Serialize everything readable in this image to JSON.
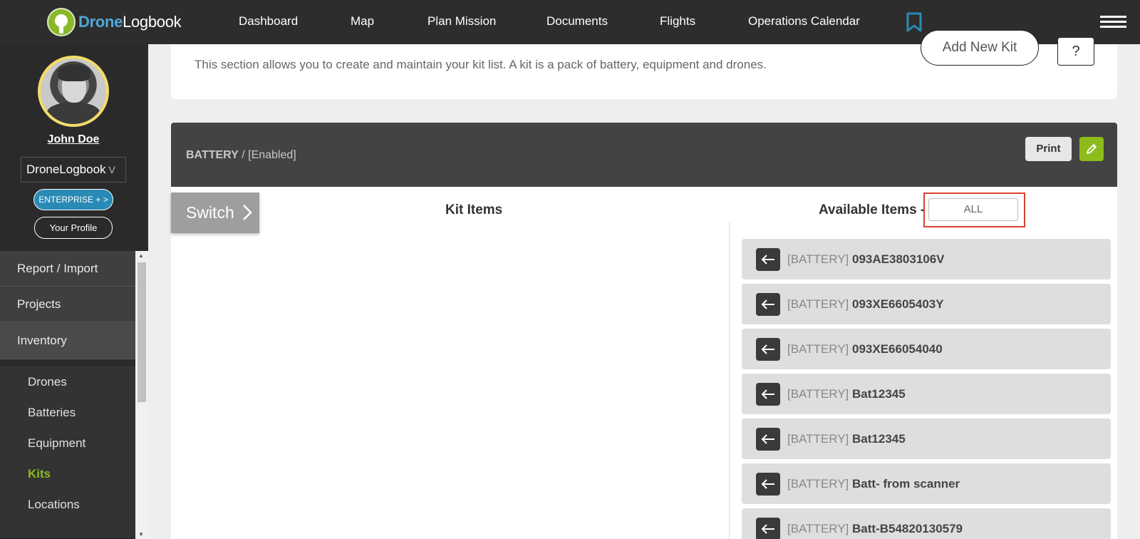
{
  "nav": {
    "logo_drone": "Drone",
    "logo_logbook": "Logbook",
    "links": [
      "Dashboard",
      "Map",
      "Plan Mission",
      "Documents",
      "Flights",
      "Operations Calendar"
    ],
    "bookmark_color": "#2a8ab6"
  },
  "sidebar": {
    "user_name": "John Doe",
    "org": "DroneLogbook",
    "org_chevron": "V",
    "enterprise_label": "ENTERPRISE + >",
    "profile_label": "Your Profile",
    "menu": [
      "Report / Import",
      "Projects",
      "Inventory"
    ],
    "submenu": [
      "Drones",
      "Batteries",
      "Equipment",
      "Kits",
      "Locations"
    ],
    "active_submenu": "Kits",
    "accent_color": "#8dbb1c"
  },
  "intro": {
    "text": "This section allows you to create and maintain your kit list. A kit is a pack of battery, equipment and drones.",
    "add_kit_label": "Add New Kit",
    "help_label": "?"
  },
  "kit": {
    "type": "BATTERY",
    "status": " / [Enabled]",
    "print_label": "Print",
    "switch_label": "Switch",
    "kit_items_title": "Kit Items",
    "available_title": "Available Items -",
    "filter_value": "ALL",
    "available_items": [
      {
        "type": "[BATTERY] ",
        "name": "093AE3803106V"
      },
      {
        "type": "[BATTERY] ",
        "name": "093XE6605403Y"
      },
      {
        "type": "[BATTERY] ",
        "name": "093XE66054040"
      },
      {
        "type": "[BATTERY] ",
        "name": "Bat12345"
      },
      {
        "type": "[BATTERY] ",
        "name": "Bat12345"
      },
      {
        "type": "[BATTERY] ",
        "name": "Batt- from scanner"
      },
      {
        "type": "[BATTERY] ",
        "name": "Batt-B54820130579"
      }
    ]
  }
}
